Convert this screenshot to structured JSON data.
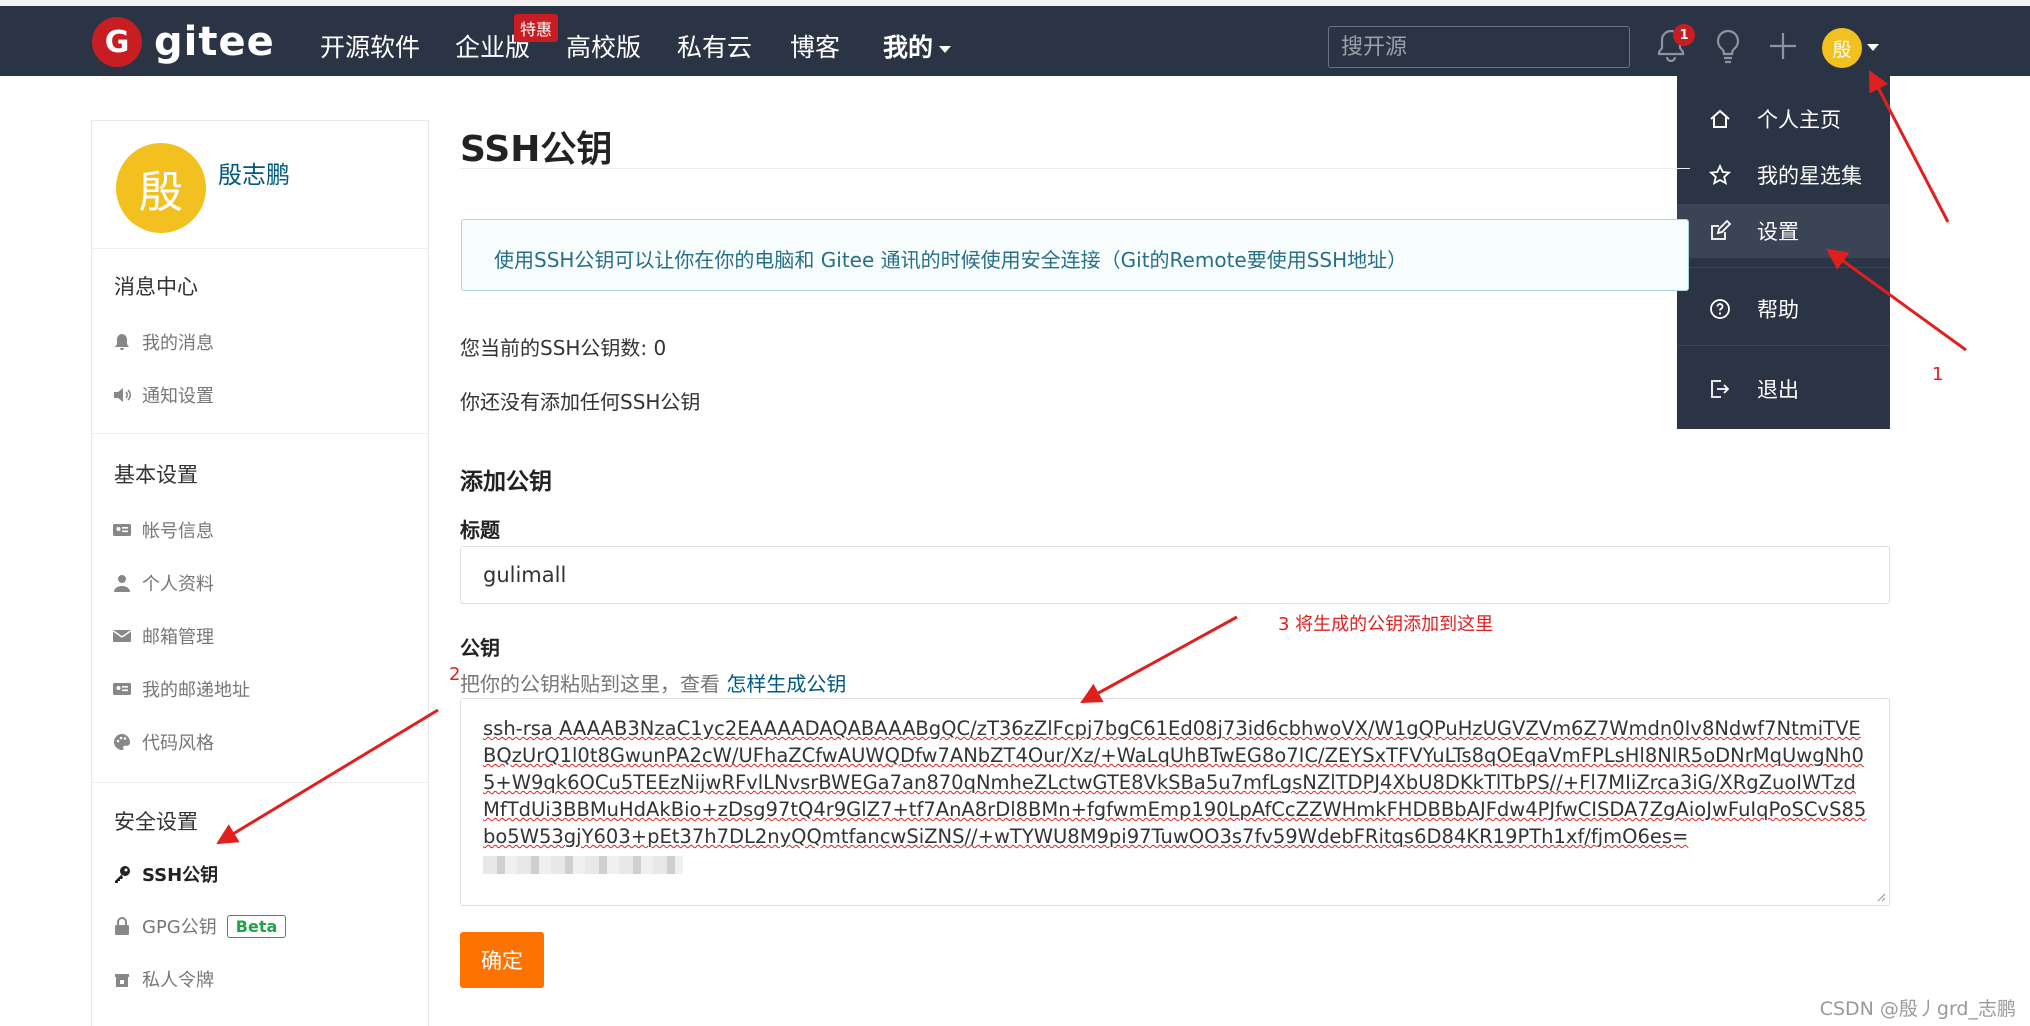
{
  "navbar": {
    "logo_mark": "G",
    "logo_text": "gitee",
    "items": [
      "开源软件",
      "企业版",
      "高校版",
      "私有云",
      "博客",
      "我的"
    ],
    "enterprise_badge": "特惠",
    "search_placeholder": "搜开源",
    "notification_count": "1",
    "avatar_char": "殷"
  },
  "dropdown": {
    "items": [
      "个人主页",
      "我的星选集",
      "设置",
      "帮助",
      "退出"
    ],
    "active": "设置"
  },
  "sidebar": {
    "avatar_char": "殷",
    "user_name": "殷志鹏",
    "sections": {
      "messages": {
        "title": "消息中心",
        "items": [
          "我的消息",
          "通知设置"
        ]
      },
      "basic": {
        "title": "基本设置",
        "items": [
          "帐号信息",
          "个人资料",
          "邮箱管理",
          "我的邮递地址",
          "代码风格"
        ]
      },
      "security": {
        "title": "安全设置",
        "items": [
          "SSH公钥",
          "GPG公钥",
          "私人令牌"
        ],
        "beta_label": "Beta"
      }
    }
  },
  "main": {
    "title": "SSH公钥",
    "info": "使用SSH公钥可以让你在你的电脑和 Gitee 通讯的时候使用安全连接（Git的Remote要使用SSH地址）",
    "key_count": "您当前的SSH公钥数: 0",
    "no_keys": "你还没有添加任何SSH公钥",
    "add_title": "添加公钥",
    "title_label": "标题",
    "title_value": "gulimall",
    "key_label": "公钥",
    "key_hint": "把你的公钥粘贴到这里，查看",
    "key_hint_link": "怎样生成公钥",
    "key_value": "ssh-rsa AAAAB3NzaC1yc2EAAAADAQABAAABgQC/zT36zZlFcpj7bgC61Ed08j73id6cbhwoVX/W1gQPuHzUGVZVm6Z7Wmdn0Iv8Ndwf7NtmiTVEBQzUrQ1l0t8GwunPA2cW/UFhaZCfwAUWQDfw7ANbZT4Our/Xz/+WaLqUhBTwEG8o7IC/ZEYSxTFVYuLTs8qOEqaVmFPLsHl8NlR5oDNrMqUwgNh05+W9qk6OCu5TEEzNijwRFvlLNvsrBWEGa7an870qNmheZLctwGTE8VkSBa5u7mfLgsNZlTDPJ4XbU8DKkTlTbPS//+Fl7MIiZrca3iG/XRgZuoIWTzdMfTdUi3BBMuHdAkBio+zDsg97tQ4r9GlZ7+tf7AnA8rDl8BMn+fgfwmEmp190LpAfCcZZWHmkFHDBBbAJFdw4PJfwCISDA7ZgAioJwFuIqPoSCvS85bo5W53gjY603+pEt37h7DL2nyQQmtfancwSiZNS//+wTYWU8M9pi97TuwOO3s7fv59WdebFRitqs6D84KR19PTh1xf/fjmO6es=",
    "submit_label": "确定"
  },
  "annotations": {
    "step1": "1",
    "step2": "2",
    "step3": "3 将生成的公钥添加到这里"
  },
  "watermark": "CSDN @殷丿grd_志鹏",
  "colors": {
    "navbar_bg": "#2b3444",
    "brand_red": "#c71d23",
    "avatar_yellow": "#f2c11f",
    "submit_orange": "#fe7300",
    "link_blue": "#005980",
    "annotation_red": "#e02020"
  }
}
